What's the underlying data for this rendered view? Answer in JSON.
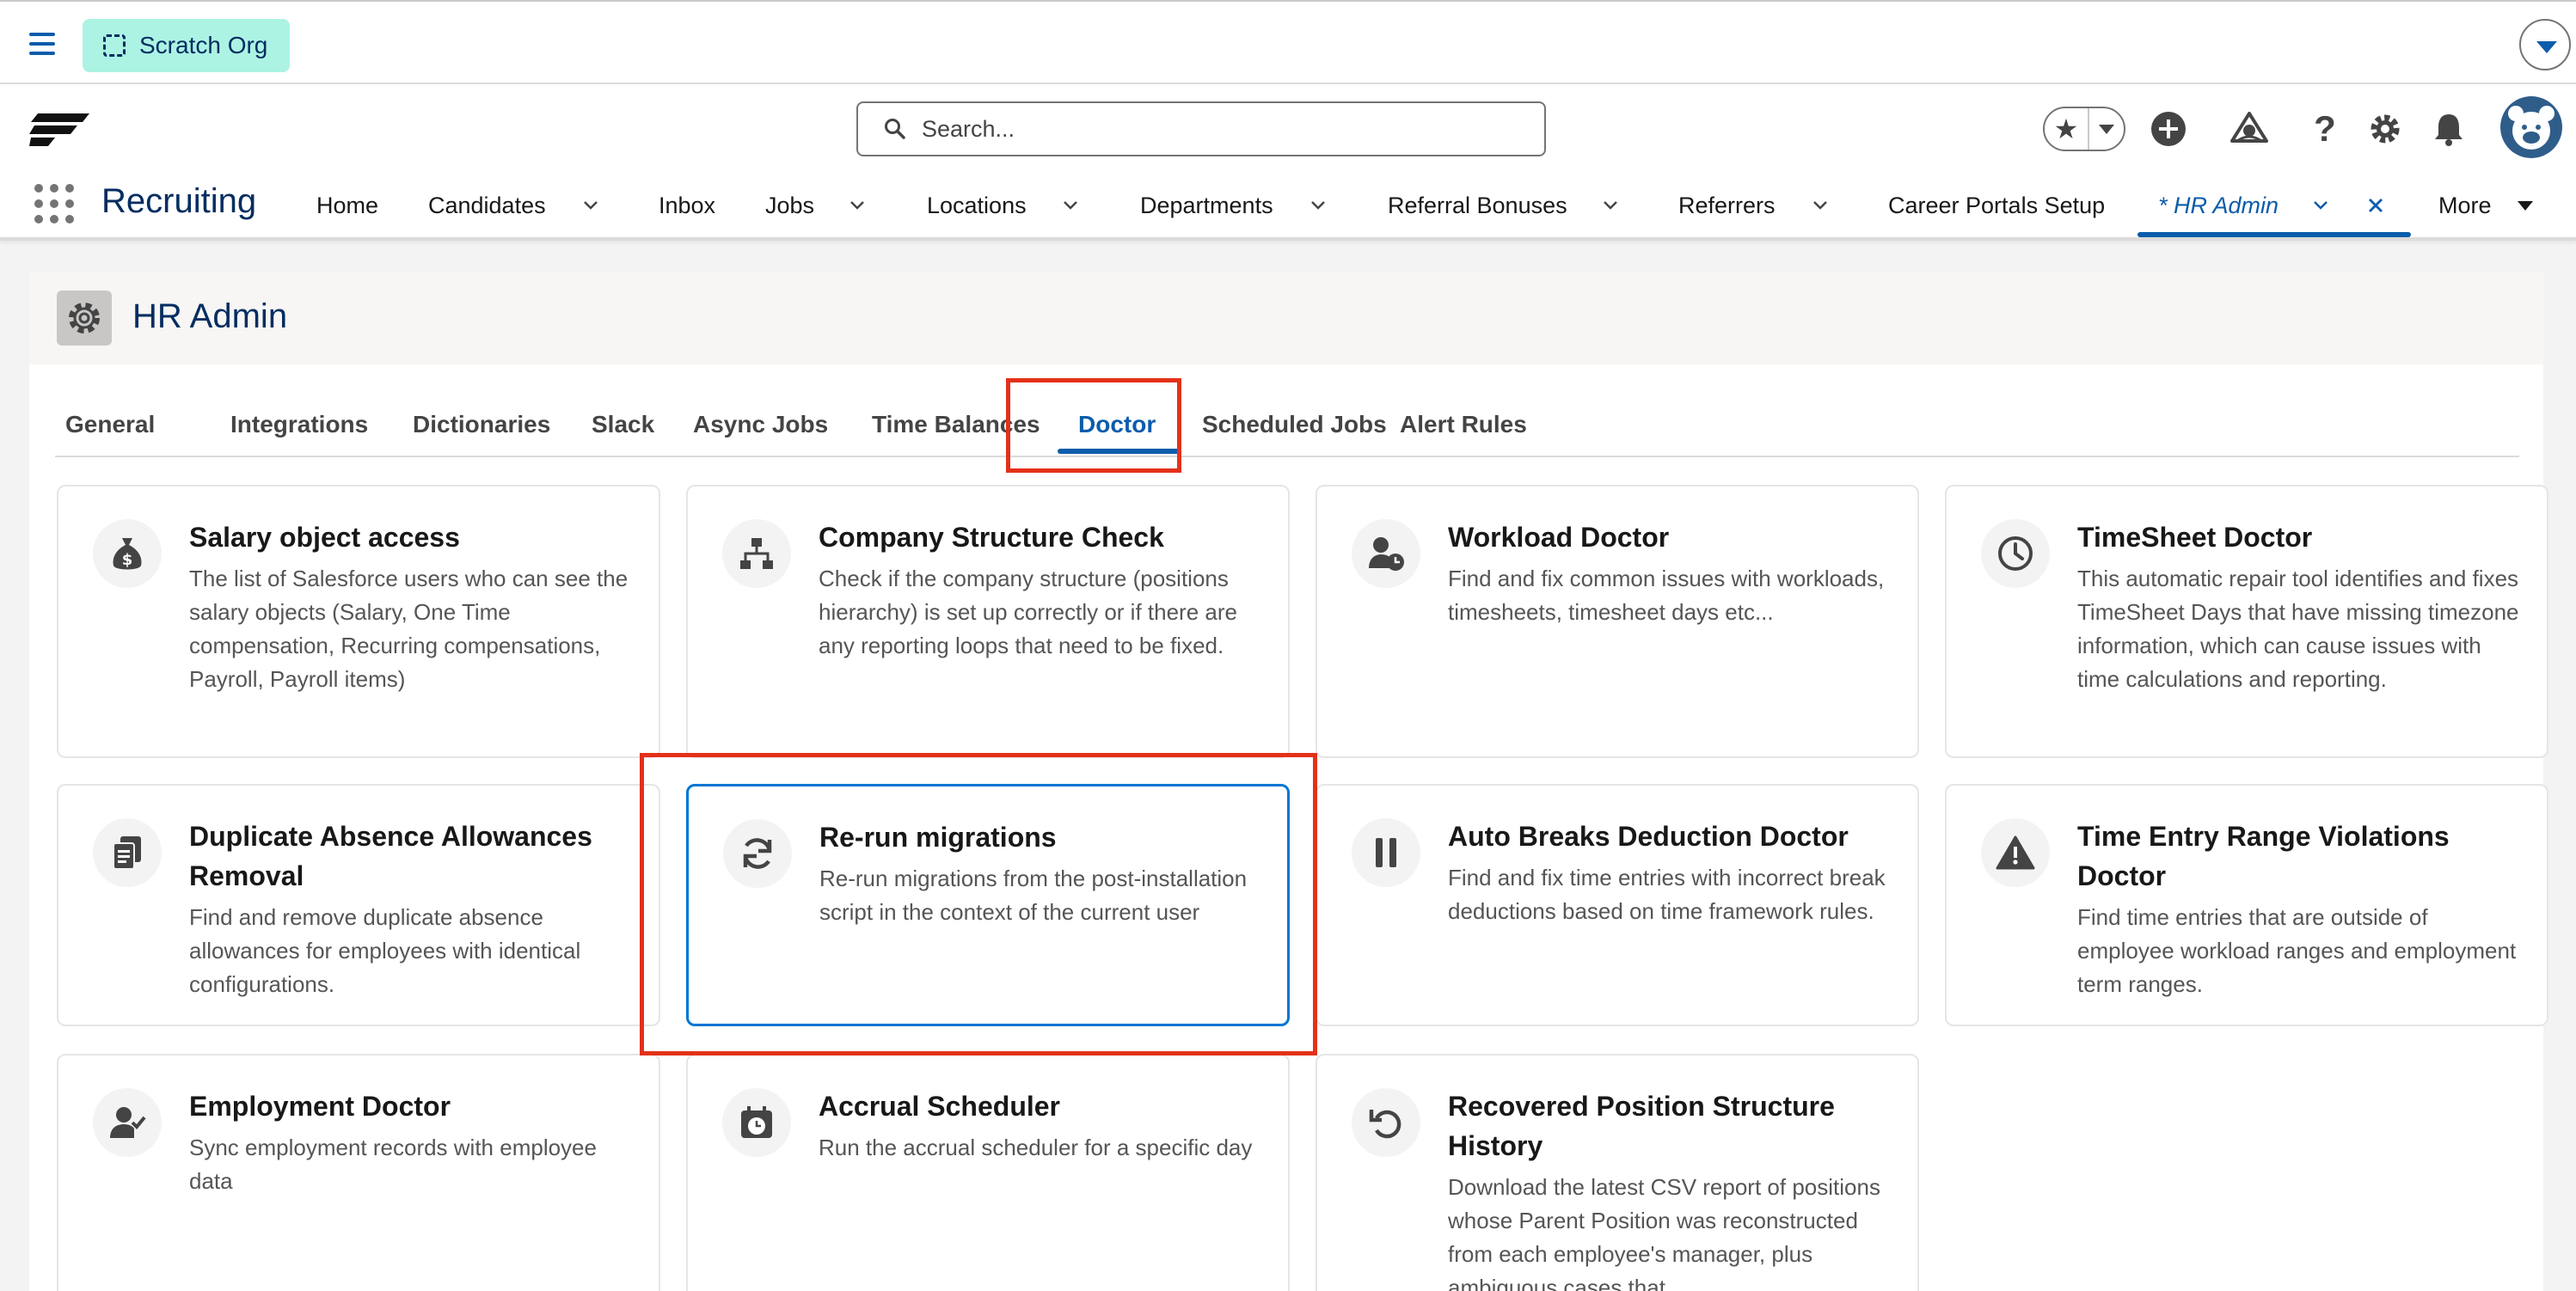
{
  "org_bar": {
    "org_label": "Scratch Org"
  },
  "global_header": {
    "search_placeholder": "Search..."
  },
  "app_nav": {
    "app_name": "Recruiting",
    "items": [
      {
        "label": "Home"
      },
      {
        "label": "Candidates"
      },
      {
        "label": "Inbox"
      },
      {
        "label": "Jobs"
      },
      {
        "label": "Locations"
      },
      {
        "label": "Departments"
      },
      {
        "label": "Referral Bonuses"
      },
      {
        "label": "Referrers"
      },
      {
        "label": "Career Portals Setup"
      },
      {
        "label": "* HR Admin"
      },
      {
        "label": "More"
      }
    ]
  },
  "page": {
    "title": "HR Admin"
  },
  "tabs": [
    {
      "label": "General"
    },
    {
      "label": "Integrations"
    },
    {
      "label": "Dictionaries"
    },
    {
      "label": "Slack"
    },
    {
      "label": "Async Jobs"
    },
    {
      "label": "Time Balances"
    },
    {
      "label": "Doctor"
    },
    {
      "label": "Scheduled Jobs"
    },
    {
      "label": "Alert Rules"
    }
  ],
  "active_tab": "Doctor",
  "cards": [
    {
      "title": "Salary object access",
      "description": "The list of Salesforce users who can see the salary objects (Salary, One Time compensation, Recurring compensations, Payroll, Payroll items)",
      "icon": "money-bag-icon"
    },
    {
      "title": "Company Structure Check",
      "description": "Check if the company structure (positions hierarchy) is set up correctly or if there are any reporting loops that need to be fixed.",
      "icon": "hierarchy-icon"
    },
    {
      "title": "Workload Doctor",
      "description": "Find and fix common issues with workloads, timesheets, timesheet days etc...",
      "icon": "user-clock-icon"
    },
    {
      "title": "TimeSheet Doctor",
      "description": "This automatic repair tool identifies and fixes TimeSheet Days that have missing timezone information, which can cause issues with time calculations and reporting.",
      "icon": "clock-icon"
    },
    {
      "title": "Duplicate Absence Allowances Removal",
      "description": "Find and remove duplicate absence allowances for employees with identical configurations.",
      "icon": "documents-icon"
    },
    {
      "title": "Re-run migrations",
      "description": "Re-run migrations from the post-installation script in the context of the current user",
      "icon": "refresh-icon"
    },
    {
      "title": "Auto Breaks Deduction Doctor",
      "description": "Find and fix time entries with incorrect break deductions based on time framework rules.",
      "icon": "pause-icon"
    },
    {
      "title": "Time Entry Range Violations Doctor",
      "description": "Find time entries that are outside of employee workload ranges and employment term ranges.",
      "icon": "warning-icon"
    },
    {
      "title": "Employment Doctor",
      "description": "Sync employment records with employee data",
      "icon": "user-check-icon"
    },
    {
      "title": "Accrual Scheduler",
      "description": "Run the accrual scheduler for a specific day",
      "icon": "calendar-clock-icon"
    },
    {
      "title": "Recovered Position Structure History",
      "description": "Download the latest CSV report of positions whose Parent Position was reconstructed from each employee's manager, plus ambiguous cases that",
      "icon": "undo-icon"
    }
  ],
  "colors": {
    "brand_blue": "#0b5cab",
    "highlight_red": "#e3311a",
    "org_pill": "#acf3e4"
  }
}
